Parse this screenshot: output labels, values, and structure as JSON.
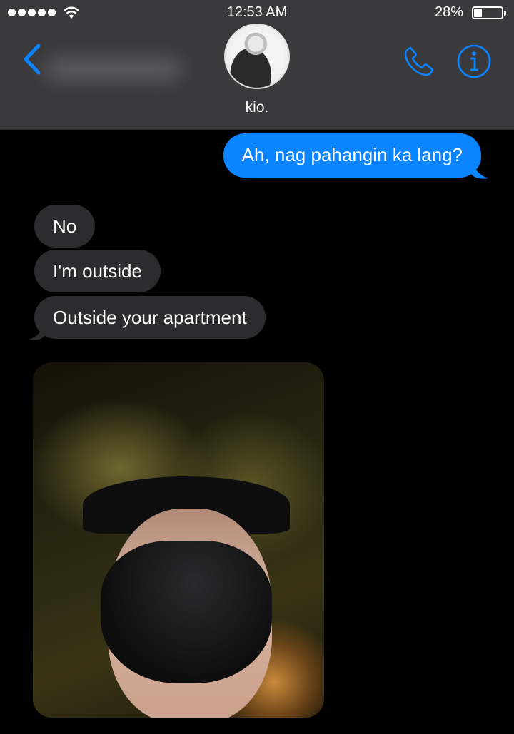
{
  "status_bar": {
    "time": "12:53 AM",
    "battery_percent": "28%",
    "battery_level": 0.28,
    "signal_bars": 5
  },
  "nav": {
    "contact_name": "kio.",
    "back_icon": "chevron-left-icon",
    "call_icon": "phone-icon",
    "info_icon": "info-icon"
  },
  "messages": [
    {
      "direction": "outgoing",
      "text": "Ah, nag pahangin ka lang?"
    },
    {
      "direction": "incoming",
      "text": "No"
    },
    {
      "direction": "incoming",
      "text": "I'm outside"
    },
    {
      "direction": "incoming",
      "text": "Outside your apartment"
    }
  ],
  "colors": {
    "header_bg": "#3a3a3c",
    "accent": "#0a84ff",
    "incoming_bubble": "#2c2c2e",
    "background": "#000000"
  }
}
